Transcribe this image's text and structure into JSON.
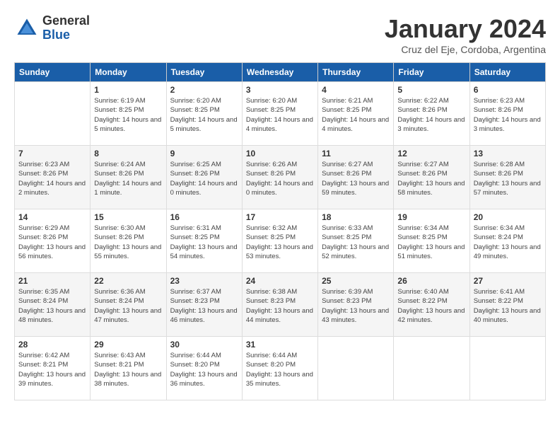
{
  "app": {
    "logo_general": "General",
    "logo_blue": "Blue"
  },
  "header": {
    "title": "January 2024",
    "location": "Cruz del Eje, Cordoba, Argentina"
  },
  "calendar": {
    "days_of_week": [
      "Sunday",
      "Monday",
      "Tuesday",
      "Wednesday",
      "Thursday",
      "Friday",
      "Saturday"
    ],
    "weeks": [
      [
        {
          "day": "",
          "sunrise": "",
          "sunset": "",
          "daylight": ""
        },
        {
          "day": "1",
          "sunrise": "Sunrise: 6:19 AM",
          "sunset": "Sunset: 8:25 PM",
          "daylight": "Daylight: 14 hours and 5 minutes."
        },
        {
          "day": "2",
          "sunrise": "Sunrise: 6:20 AM",
          "sunset": "Sunset: 8:25 PM",
          "daylight": "Daylight: 14 hours and 5 minutes."
        },
        {
          "day": "3",
          "sunrise": "Sunrise: 6:20 AM",
          "sunset": "Sunset: 8:25 PM",
          "daylight": "Daylight: 14 hours and 4 minutes."
        },
        {
          "day": "4",
          "sunrise": "Sunrise: 6:21 AM",
          "sunset": "Sunset: 8:25 PM",
          "daylight": "Daylight: 14 hours and 4 minutes."
        },
        {
          "day": "5",
          "sunrise": "Sunrise: 6:22 AM",
          "sunset": "Sunset: 8:26 PM",
          "daylight": "Daylight: 14 hours and 3 minutes."
        },
        {
          "day": "6",
          "sunrise": "Sunrise: 6:23 AM",
          "sunset": "Sunset: 8:26 PM",
          "daylight": "Daylight: 14 hours and 3 minutes."
        }
      ],
      [
        {
          "day": "7",
          "sunrise": "Sunrise: 6:23 AM",
          "sunset": "Sunset: 8:26 PM",
          "daylight": "Daylight: 14 hours and 2 minutes."
        },
        {
          "day": "8",
          "sunrise": "Sunrise: 6:24 AM",
          "sunset": "Sunset: 8:26 PM",
          "daylight": "Daylight: 14 hours and 1 minute."
        },
        {
          "day": "9",
          "sunrise": "Sunrise: 6:25 AM",
          "sunset": "Sunset: 8:26 PM",
          "daylight": "Daylight: 14 hours and 0 minutes."
        },
        {
          "day": "10",
          "sunrise": "Sunrise: 6:26 AM",
          "sunset": "Sunset: 8:26 PM",
          "daylight": "Daylight: 14 hours and 0 minutes."
        },
        {
          "day": "11",
          "sunrise": "Sunrise: 6:27 AM",
          "sunset": "Sunset: 8:26 PM",
          "daylight": "Daylight: 13 hours and 59 minutes."
        },
        {
          "day": "12",
          "sunrise": "Sunrise: 6:27 AM",
          "sunset": "Sunset: 8:26 PM",
          "daylight": "Daylight: 13 hours and 58 minutes."
        },
        {
          "day": "13",
          "sunrise": "Sunrise: 6:28 AM",
          "sunset": "Sunset: 8:26 PM",
          "daylight": "Daylight: 13 hours and 57 minutes."
        }
      ],
      [
        {
          "day": "14",
          "sunrise": "Sunrise: 6:29 AM",
          "sunset": "Sunset: 8:26 PM",
          "daylight": "Daylight: 13 hours and 56 minutes."
        },
        {
          "day": "15",
          "sunrise": "Sunrise: 6:30 AM",
          "sunset": "Sunset: 8:26 PM",
          "daylight": "Daylight: 13 hours and 55 minutes."
        },
        {
          "day": "16",
          "sunrise": "Sunrise: 6:31 AM",
          "sunset": "Sunset: 8:25 PM",
          "daylight": "Daylight: 13 hours and 54 minutes."
        },
        {
          "day": "17",
          "sunrise": "Sunrise: 6:32 AM",
          "sunset": "Sunset: 8:25 PM",
          "daylight": "Daylight: 13 hours and 53 minutes."
        },
        {
          "day": "18",
          "sunrise": "Sunrise: 6:33 AM",
          "sunset": "Sunset: 8:25 PM",
          "daylight": "Daylight: 13 hours and 52 minutes."
        },
        {
          "day": "19",
          "sunrise": "Sunrise: 6:34 AM",
          "sunset": "Sunset: 8:25 PM",
          "daylight": "Daylight: 13 hours and 51 minutes."
        },
        {
          "day": "20",
          "sunrise": "Sunrise: 6:34 AM",
          "sunset": "Sunset: 8:24 PM",
          "daylight": "Daylight: 13 hours and 49 minutes."
        }
      ],
      [
        {
          "day": "21",
          "sunrise": "Sunrise: 6:35 AM",
          "sunset": "Sunset: 8:24 PM",
          "daylight": "Daylight: 13 hours and 48 minutes."
        },
        {
          "day": "22",
          "sunrise": "Sunrise: 6:36 AM",
          "sunset": "Sunset: 8:24 PM",
          "daylight": "Daylight: 13 hours and 47 minutes."
        },
        {
          "day": "23",
          "sunrise": "Sunrise: 6:37 AM",
          "sunset": "Sunset: 8:23 PM",
          "daylight": "Daylight: 13 hours and 46 minutes."
        },
        {
          "day": "24",
          "sunrise": "Sunrise: 6:38 AM",
          "sunset": "Sunset: 8:23 PM",
          "daylight": "Daylight: 13 hours and 44 minutes."
        },
        {
          "day": "25",
          "sunrise": "Sunrise: 6:39 AM",
          "sunset": "Sunset: 8:23 PM",
          "daylight": "Daylight: 13 hours and 43 minutes."
        },
        {
          "day": "26",
          "sunrise": "Sunrise: 6:40 AM",
          "sunset": "Sunset: 8:22 PM",
          "daylight": "Daylight: 13 hours and 42 minutes."
        },
        {
          "day": "27",
          "sunrise": "Sunrise: 6:41 AM",
          "sunset": "Sunset: 8:22 PM",
          "daylight": "Daylight: 13 hours and 40 minutes."
        }
      ],
      [
        {
          "day": "28",
          "sunrise": "Sunrise: 6:42 AM",
          "sunset": "Sunset: 8:21 PM",
          "daylight": "Daylight: 13 hours and 39 minutes."
        },
        {
          "day": "29",
          "sunrise": "Sunrise: 6:43 AM",
          "sunset": "Sunset: 8:21 PM",
          "daylight": "Daylight: 13 hours and 38 minutes."
        },
        {
          "day": "30",
          "sunrise": "Sunrise: 6:44 AM",
          "sunset": "Sunset: 8:20 PM",
          "daylight": "Daylight: 13 hours and 36 minutes."
        },
        {
          "day": "31",
          "sunrise": "Sunrise: 6:44 AM",
          "sunset": "Sunset: 8:20 PM",
          "daylight": "Daylight: 13 hours and 35 minutes."
        },
        {
          "day": "",
          "sunrise": "",
          "sunset": "",
          "daylight": ""
        },
        {
          "day": "",
          "sunrise": "",
          "sunset": "",
          "daylight": ""
        },
        {
          "day": "",
          "sunrise": "",
          "sunset": "",
          "daylight": ""
        }
      ]
    ]
  }
}
